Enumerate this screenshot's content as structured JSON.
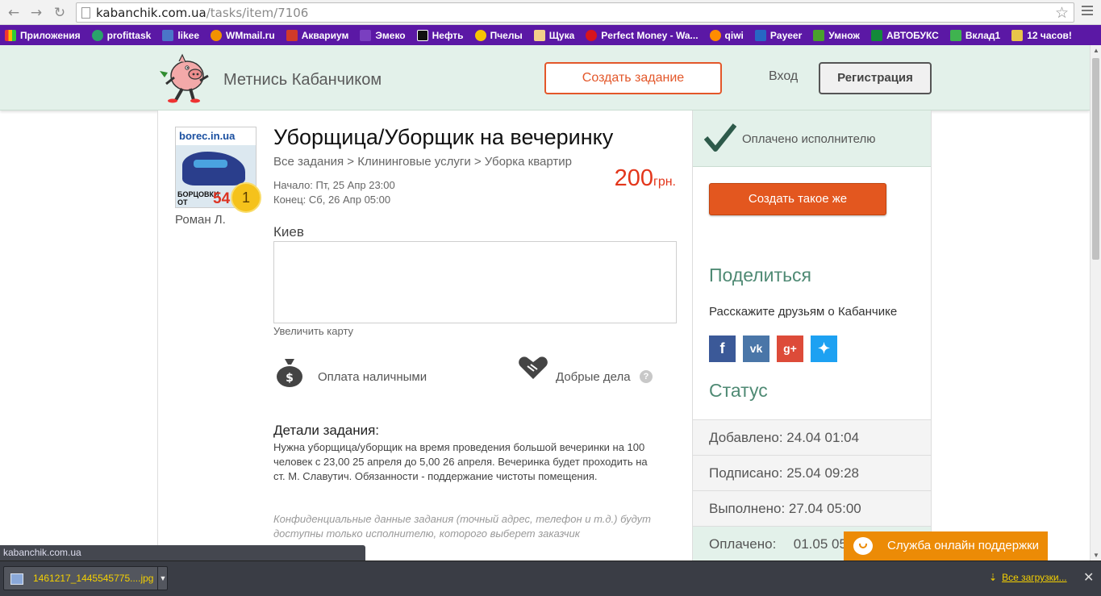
{
  "browser": {
    "url_host": "kabanchik.com.ua",
    "url_path": "/tasks/item/7106",
    "bookmarks": [
      "Приложения",
      "profittask",
      "likee",
      "WMmail.ru",
      "Аквариум",
      "Эмеко",
      "Нефть",
      "Пчелы",
      "Щука",
      "Perfect Money - Wa...",
      "qiwi",
      "Payeer",
      "Умнож",
      "АВТОБУКС",
      "Вклад1",
      "12 часов!"
    ],
    "status_url": "kabanchik.com.ua",
    "download_file": "1461217_1445545775....jpg",
    "all_downloads": "Все загрузки..."
  },
  "header": {
    "brand": "Метнись Кабанчиком",
    "create_task": "Создать задание",
    "login": "Вход",
    "register": "Регистрация"
  },
  "task": {
    "avatar_brand": "borec.in.ua",
    "avatar_caption": "БОРЦОВКИ ОТ",
    "avatar_price": "54",
    "rating": "1",
    "author": "Роман Л.",
    "title": "Уборщица/Уборщик на вечеринку",
    "breadcrumb": "Все задания > Клининговые услуги > Уборка квартир",
    "start": "Начало: Пт, 25 Апр 23:00",
    "end": "Конец: Сб, 26 Апр 05:00",
    "price": "200",
    "currency": "грн.",
    "city": "Киев",
    "map_link": "Увеличить карту",
    "payment": "Оплата наличными",
    "good_deeds": "Добрые дела",
    "details_heading": "Детали задания:",
    "details_text": "Нужна уборщица/уборщик на время проведения большой вечеринки на 100 человек с 23,00 25 апреля до 5,00 26 апреля. Вечеринка будет проходить на ст. М. Славутич. Обязанности - поддержание чистоты помещения.",
    "confidential": "Конфиденциальные данные задания (точный адрес, телефон и т.д.) будут доступны только исполнителю, которого выберет заказчик"
  },
  "sidebar": {
    "paid_label": "Оплачено исполнителю",
    "create_same": "Создать такое же",
    "share_heading": "Поделиться",
    "share_text": "Расскажите друзьям о Кабанчике",
    "status_heading": "Статус",
    "status_rows": [
      {
        "label": "Добавлено:",
        "value": "24.04 01:04"
      },
      {
        "label": "Подписано:",
        "value": "25.04 09:28"
      },
      {
        "label": "Выполнено:",
        "value": "27.04 05:00"
      },
      {
        "label": "Оплачено:",
        "value": "01.05 05"
      }
    ]
  },
  "support": {
    "label": "Служба онлайн поддержки"
  },
  "colors": {
    "accent_orange": "#e3572a",
    "price_red": "#e3361b",
    "header_green": "#e3f1ea",
    "heading_green": "#4f8a74",
    "bookmark_bar": "#5b18a5"
  }
}
